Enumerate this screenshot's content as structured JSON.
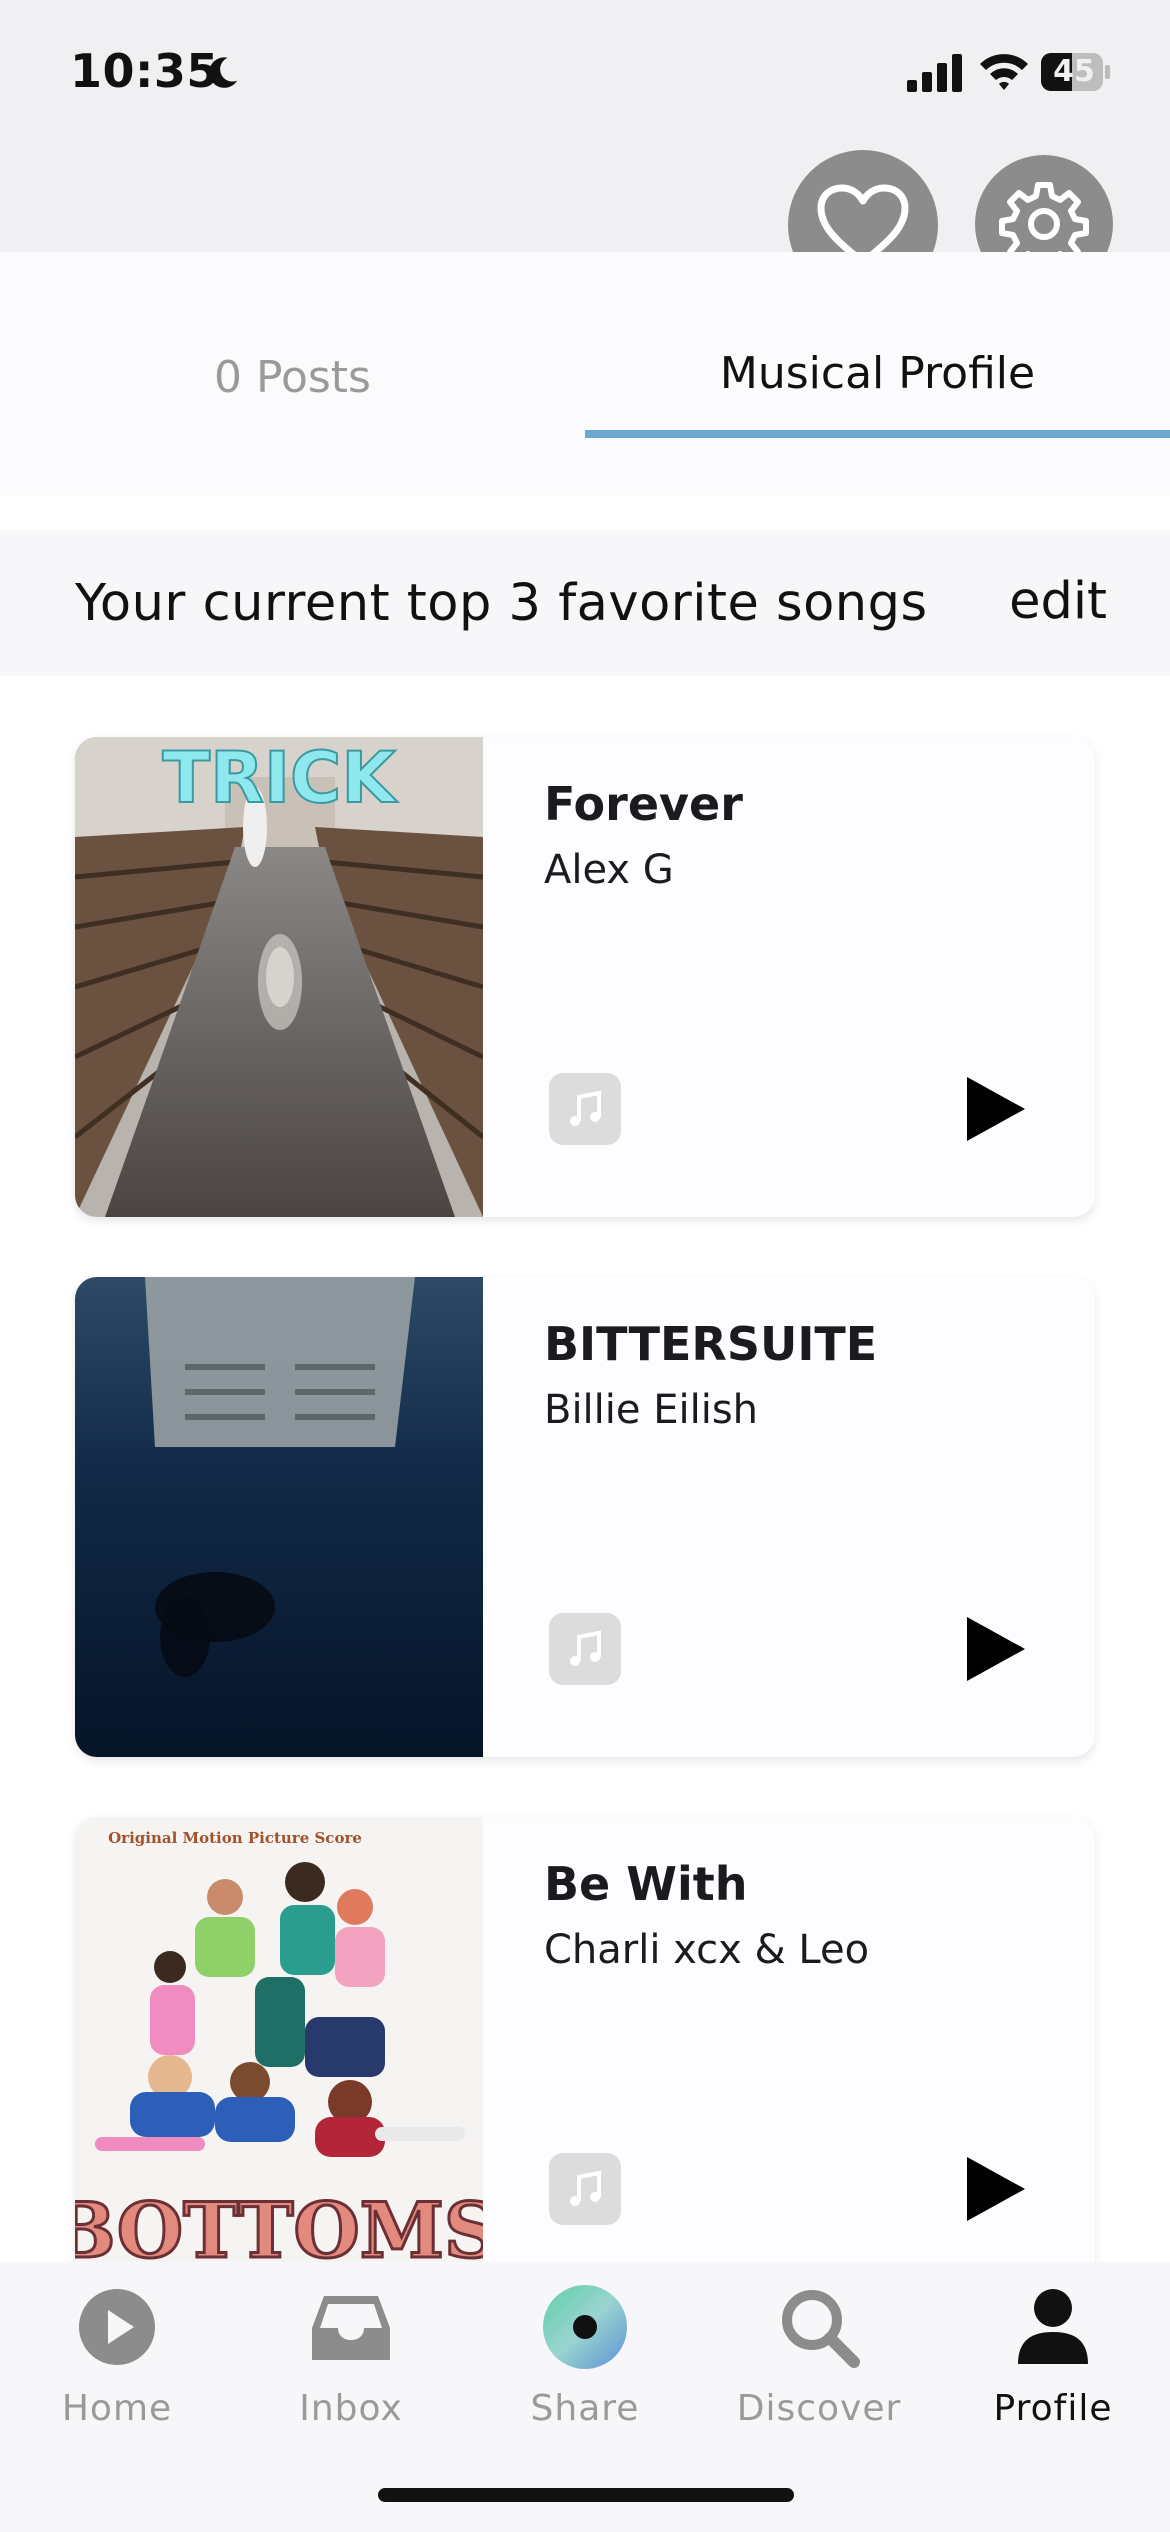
{
  "status_bar": {
    "time": "10:35",
    "battery": "45"
  },
  "tabs": {
    "posts": "0 Posts",
    "musical_profile": "Musical Profile"
  },
  "section": {
    "title": "Your current top 3 favorite songs",
    "edit": "edit"
  },
  "songs": [
    {
      "title": "Forever",
      "artist": "Alex G",
      "art_text": "TRICK"
    },
    {
      "title": "BITTERSUITE",
      "artist": "Billie Eilish"
    },
    {
      "title": "Be With",
      "artist": "Charli xcx & Leo",
      "art_text": "BOTTOMS",
      "art_subtext": "Original Motion Picture Score"
    }
  ],
  "tabbar": [
    {
      "label": "Home",
      "icon": "play-circle-icon"
    },
    {
      "label": "Inbox",
      "icon": "inbox-icon"
    },
    {
      "label": "Share",
      "icon": "share-disc-icon"
    },
    {
      "label": "Discover",
      "icon": "search-icon"
    },
    {
      "label": "Profile",
      "icon": "person-icon"
    }
  ],
  "colors": {
    "accent_underline": "#6fa8cf",
    "icon_gray": "#8c8c8c"
  }
}
